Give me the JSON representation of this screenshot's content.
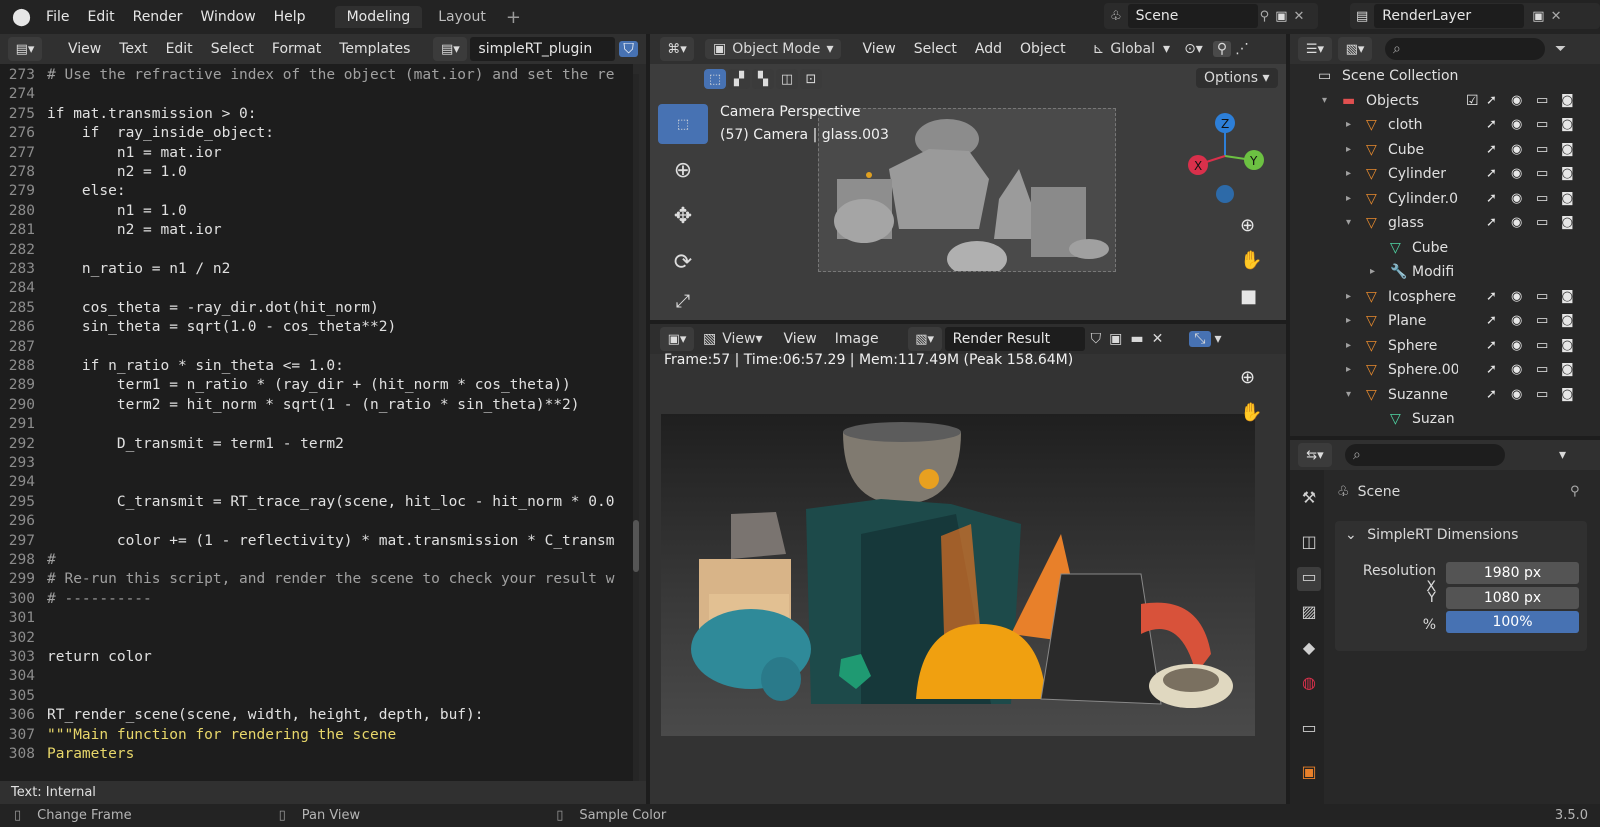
{
  "menu": {
    "file": "File",
    "edit": "Edit",
    "render": "Render",
    "window": "Window",
    "help": "Help"
  },
  "workspaces": [
    "Modeling",
    "Layout"
  ],
  "scene": {
    "name": "Scene"
  },
  "renderlayer": {
    "name": "RenderLayer"
  },
  "text_editor": {
    "menu": [
      "View",
      "Text",
      "Edit",
      "Select",
      "Format",
      "Templates"
    ],
    "filename": "simpleRT_plugin",
    "status": "Text: Internal",
    "lines": [
      {
        "n": "273",
        "t": "# Use the refractive index of the object (mat.ior) and set the re",
        "c": "comment"
      },
      {
        "n": "274",
        "t": "",
        "c": "plain"
      },
      {
        "n": "275",
        "t": "if mat.transmission > 0:",
        "c": "plain"
      },
      {
        "n": "276",
        "t": "    if  ray_inside_object:",
        "c": "plain"
      },
      {
        "n": "277",
        "t": "        n1 = mat.ior",
        "c": "plain"
      },
      {
        "n": "278",
        "t": "        n2 = 1.0",
        "c": "plain"
      },
      {
        "n": "279",
        "t": "    else:",
        "c": "plain"
      },
      {
        "n": "280",
        "t": "        n1 = 1.0",
        "c": "plain"
      },
      {
        "n": "281",
        "t": "        n2 = mat.ior",
        "c": "plain"
      },
      {
        "n": "282",
        "t": "",
        "c": "plain"
      },
      {
        "n": "283",
        "t": "    n_ratio = n1 / n2",
        "c": "plain"
      },
      {
        "n": "284",
        "t": "",
        "c": "plain"
      },
      {
        "n": "285",
        "t": "    cos_theta = -ray_dir.dot(hit_norm)",
        "c": "plain"
      },
      {
        "n": "286",
        "t": "    sin_theta = sqrt(1.0 - cos_theta**2)",
        "c": "plain"
      },
      {
        "n": "287",
        "t": "",
        "c": "plain"
      },
      {
        "n": "288",
        "t": "    if n_ratio * sin_theta <= 1.0:",
        "c": "plain"
      },
      {
        "n": "289",
        "t": "        term1 = n_ratio * (ray_dir + (hit_norm * cos_theta))",
        "c": "plain"
      },
      {
        "n": "290",
        "t": "        term2 = hit_norm * sqrt(1 - (n_ratio * sin_theta)**2)",
        "c": "plain"
      },
      {
        "n": "291",
        "t": "",
        "c": "plain"
      },
      {
        "n": "292",
        "t": "        D_transmit = term1 - term2",
        "c": "plain"
      },
      {
        "n": "293",
        "t": "",
        "c": "plain"
      },
      {
        "n": "294",
        "t": "",
        "c": "plain"
      },
      {
        "n": "295",
        "t": "        C_transmit = RT_trace_ray(scene, hit_loc - hit_norm * 0.0",
        "c": "plain"
      },
      {
        "n": "296",
        "t": "",
        "c": "plain"
      },
      {
        "n": "297",
        "t": "        color += (1 - reflectivity) * mat.transmission * C_transm",
        "c": "plain"
      },
      {
        "n": "298",
        "t": "#",
        "c": "comment"
      },
      {
        "n": "299",
        "t": "# Re-run this script, and render the scene to check your result w",
        "c": "comment"
      },
      {
        "n": "300",
        "t": "# ----------",
        "c": "comment"
      },
      {
        "n": "301",
        "t": "",
        "c": "plain"
      },
      {
        "n": "302",
        "t": "",
        "c": "plain"
      },
      {
        "n": "303",
        "t": "return color",
        "c": "plain"
      },
      {
        "n": "304",
        "t": "",
        "c": "plain"
      },
      {
        "n": "305",
        "t": "",
        "c": "plain"
      },
      {
        "n": "306",
        "t": "RT_render_scene(scene, width, height, depth, buf):",
        "c": "plain"
      },
      {
        "n": "307",
        "t": "\"\"\"Main function for rendering the scene",
        "c": "string"
      },
      {
        "n": "308",
        "t": "Parameters",
        "c": "string"
      }
    ]
  },
  "viewport": {
    "mode": "Object Mode",
    "menu": [
      "View",
      "Select",
      "Add",
      "Object"
    ],
    "orientation": "Global",
    "options": "Options",
    "overlay_title": "Camera Perspective",
    "overlay_sub": "(57) Camera | glass.003"
  },
  "image_editor": {
    "view_label": "View",
    "menu": [
      "View",
      "Image"
    ],
    "image_name": "Render Result",
    "info": "Frame:57 | Time:06:57.29 | Mem:117.49M (Peak 158.64M)"
  },
  "outliner": {
    "root": "Scene Collection",
    "collection": "Objects",
    "items": [
      "cloth",
      "Cube",
      "Cylinder",
      "Cylinder.0",
      "glass",
      "Cube",
      "Modifi",
      "Icosphere",
      "Plane",
      "Sphere",
      "Sphere.00",
      "Suzanne",
      "Suzan"
    ]
  },
  "properties": {
    "context": "Scene",
    "panel_title": "SimpleRT Dimensions",
    "res_x_label": "Resolution X",
    "res_x": "1980 px",
    "res_y_label": "Y",
    "res_y": "1080 px",
    "pct_label": "%",
    "pct": "100%"
  },
  "statusbar": {
    "change_frame": "Change Frame",
    "pan_view": "Pan View",
    "sample_color": "Sample Color",
    "version": "3.5.0"
  }
}
